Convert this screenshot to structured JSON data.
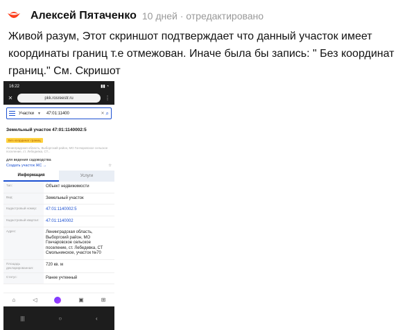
{
  "comment": {
    "author": "Алексей Пятаченко",
    "meta": "10 дней · отредактировано",
    "text": "Живой разум, Этот скриншот подтверждает что данный участок имеет координаты границ т.е отмежован. Иначе была бы запись: \" Без координат границ.\" См. Скришот"
  },
  "phone": {
    "time": "16:22",
    "url": "pkk.rosreestr.ru",
    "search_category": "Участки",
    "search_value": "47:01:11400",
    "object_title": "Земельный участок 47:01:1140002:5",
    "badge": "Без координат границ",
    "small_address": "Ленинградская область, Выборгский район, МО Гончаровское сельское поселение, ст. Лебедевка, СТ...",
    "purpose": "для ведения садоводства",
    "create_link": "Создать участок ЖС →",
    "tabs": {
      "info": "Информация",
      "services": "Услуги"
    },
    "rows": [
      {
        "label": "Тип:",
        "value": "Объект недвижимости"
      },
      {
        "label": "Вид:",
        "value": "Земельный участок"
      },
      {
        "label": "Кадастровый номер:",
        "value": "47:01:1140002:5"
      },
      {
        "label": "Кадастровый квартал:",
        "value": "47:01:1140002"
      },
      {
        "label": "Адрес:",
        "value": "Ленинградская область, Выборгский район, МО Гончаровское сельское поселение, ст. Лебедевка, СТ Смольнинское, участок №70"
      },
      {
        "label": "Площадь декларированная:",
        "value": "720 кв. м"
      },
      {
        "label": "Статус:",
        "value": "Ранее учтенный"
      }
    ]
  },
  "colors": {
    "accent": "#1a4fd1",
    "badge": "#ffd23f",
    "brand": "#fc3f1d"
  },
  "icons": [
    "yandex-logo-icon",
    "menu-icon",
    "search-icon",
    "close-icon",
    "more-icon",
    "star-icon",
    "home-icon",
    "tabs-icon",
    "alice-icon",
    "media-icon",
    "services-icon"
  ]
}
